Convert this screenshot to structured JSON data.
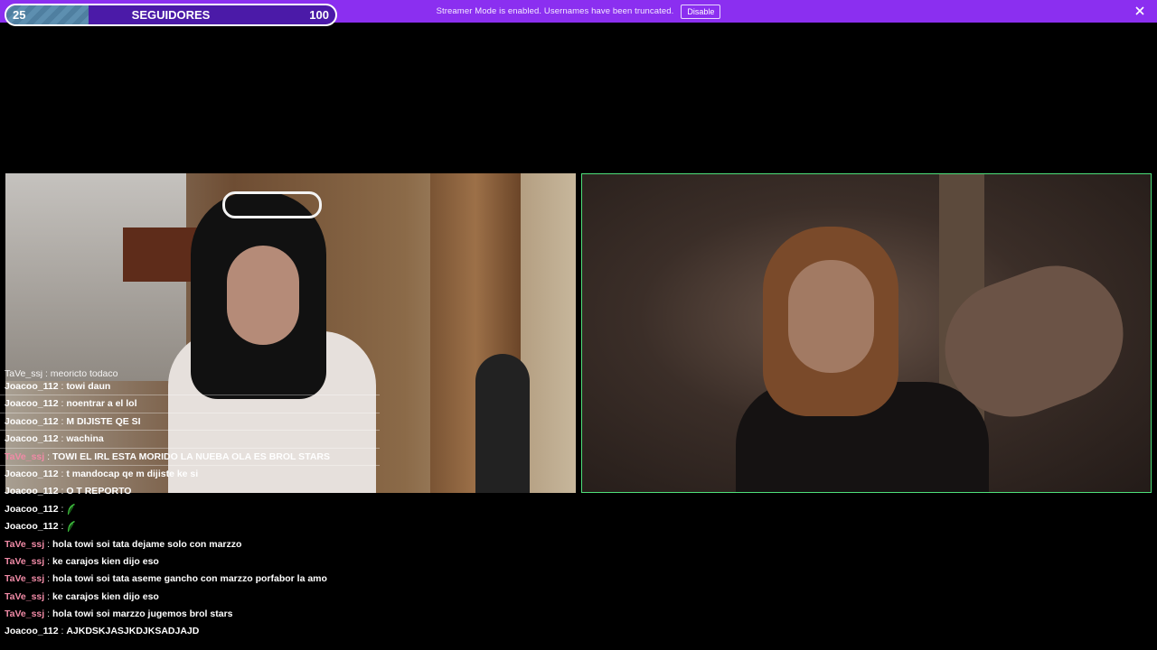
{
  "banner": {
    "message": "Streamer Mode is enabled. Usernames have been truncated.",
    "disable_label": "Disable",
    "color": "#8b2ff0"
  },
  "goal": {
    "label": "SEGUIDORES",
    "start": "25",
    "end": "100",
    "progress_fraction": 0.25
  },
  "videos": {
    "left": {
      "name": "webcam-left"
    },
    "right": {
      "name": "webcam-right",
      "border_color": "#4ee07a"
    }
  },
  "chat": {
    "partial_line": "TaVe_ssj : meoricto todaco",
    "messages": [
      {
        "user": "Joacoo_112",
        "color": "#ffffff",
        "text": "towi daun",
        "lined": true
      },
      {
        "user": "Joacoo_112",
        "color": "#ffffff",
        "text": "noentrar a el lol",
        "lined": true
      },
      {
        "user": "Joacoo_112",
        "color": "#ffffff",
        "text": "M DIJISTE QE SI",
        "lined": true
      },
      {
        "user": "Joacoo_112",
        "color": "#ffffff",
        "text": "wachina",
        "lined": true
      },
      {
        "user": "TaVe_ssj",
        "color": "#f08aa6",
        "text": "TOWI EL IRL ESTA MORIDO LA NUEBA OLA ES BROL STARS",
        "lined": true
      },
      {
        "user": "Joacoo_112",
        "color": "#ffffff",
        "text": "t mandocap qe m dijiste ke si",
        "lined": false
      },
      {
        "user": "Joacoo_112",
        "color": "#ffffff",
        "text": "O T REPORTO",
        "lined": false
      },
      {
        "user": "Joacoo_112",
        "color": "#ffffff",
        "text": "",
        "emote": "green-feather-emote",
        "lined": false
      },
      {
        "user": "Joacoo_112",
        "color": "#ffffff",
        "text": "",
        "emote": "green-feather-emote",
        "lined": false
      },
      {
        "user": "TaVe_ssj",
        "color": "#f08aa6",
        "text": "hola towi soi tata dejame solo con marzzo",
        "lined": false
      },
      {
        "user": "TaVe_ssj",
        "color": "#f08aa6",
        "text": "ke carajos kien dijo eso",
        "lined": false
      },
      {
        "user": "TaVe_ssj",
        "color": "#f08aa6",
        "text": "hola towi soi tata aseme gancho con marzzo porfabor la amo",
        "lined": false
      },
      {
        "user": "TaVe_ssj",
        "color": "#f08aa6",
        "text": "ke carajos kien dijo eso",
        "lined": false
      },
      {
        "user": "TaVe_ssj",
        "color": "#f08aa6",
        "text": "hola towi soi marzzo jugemos brol stars",
        "lined": false
      },
      {
        "user": "Joacoo_112",
        "color": "#ffffff",
        "text": "AJKDSKJASJKDJKSADJAJD",
        "lined": false
      }
    ]
  }
}
